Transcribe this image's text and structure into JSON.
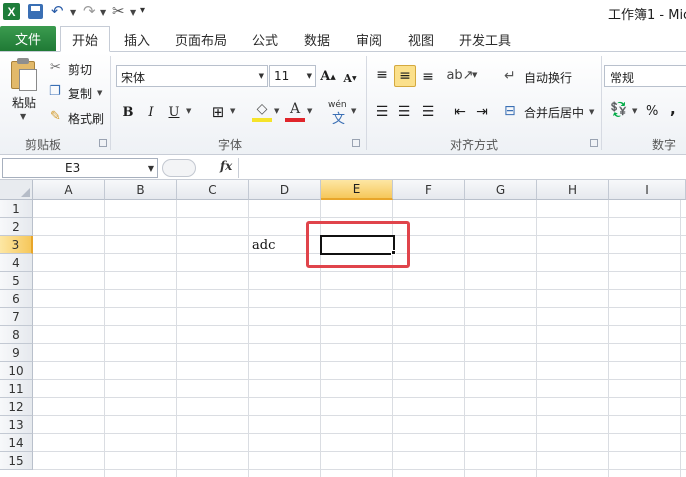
{
  "window": {
    "title": "工作簿1 - Mic",
    "app_logo": "X"
  },
  "ribbon_tabs": {
    "file": "文件",
    "items": [
      "开始",
      "插入",
      "页面布局",
      "公式",
      "数据",
      "审阅",
      "视图",
      "开发工具"
    ]
  },
  "clipboard": {
    "paste": "粘贴",
    "cut": "剪切",
    "copy": "复制",
    "format_painter": "格式刷",
    "group": "剪贴板"
  },
  "font": {
    "name": "宋体",
    "size": "11",
    "bold": "B",
    "italic": "I",
    "underline": "U",
    "grow": "A",
    "shrink": "A",
    "font_color": "A",
    "phonetic": "wén",
    "phonetic_char": "文",
    "group": "字体"
  },
  "alignment": {
    "wrap_text": "自动换行",
    "merge_center": "合并后居中",
    "group": "对齐方式"
  },
  "number": {
    "format": "常规",
    "percent": "%",
    "comma": ",",
    "group": "数字"
  },
  "formula_bar": {
    "name_box": "E3",
    "fx": "fx",
    "formula": ""
  },
  "sheet": {
    "columns": [
      "A",
      "B",
      "C",
      "D",
      "E",
      "F",
      "G",
      "H",
      "I"
    ],
    "rows": [
      "1",
      "2",
      "3",
      "4",
      "5",
      "6",
      "7",
      "8",
      "9",
      "10",
      "11",
      "12",
      "13",
      "14",
      "15"
    ],
    "selected_column": "E",
    "selected_row": "3",
    "cell_D3": "adc"
  },
  "colors": {
    "file_tab": "#217346",
    "selected_header": "#f6c75b",
    "highlight": "#e0444b"
  }
}
